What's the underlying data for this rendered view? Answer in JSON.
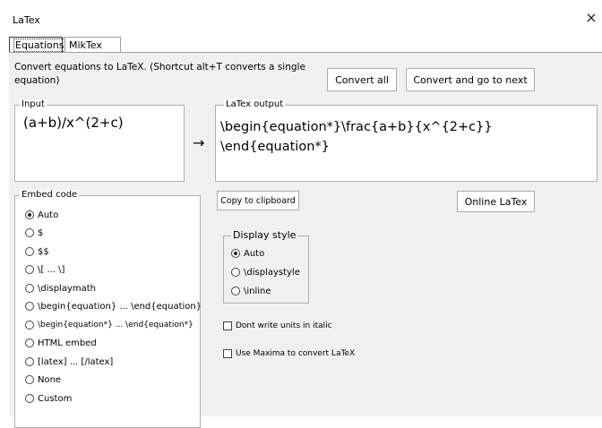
{
  "window": {
    "title": "LaTex",
    "close_glyph": "×"
  },
  "tabs": [
    {
      "label": "Equations",
      "active": true
    },
    {
      "label": "MikTex",
      "active": false
    }
  ],
  "instruction": "Convert equations to LaTeX. (Shortcut alt+T converts a single equation)",
  "buttons": {
    "convert_all": "Convert all",
    "convert_next": "Convert and go to next",
    "copy": "Copy to clipboard",
    "online": "Online LaTex"
  },
  "input": {
    "legend": "Input",
    "value": "(a+b)/x^(2+c)"
  },
  "arrow": "→",
  "output": {
    "legend": "LaTex output",
    "value": "\\begin{equation*}\\frac{a+b}{x^{2+c}}\n\\end{equation*}"
  },
  "embed": {
    "legend": "Embed code",
    "options": [
      {
        "label": "Auto",
        "checked": true
      },
      {
        "label": "$",
        "checked": false
      },
      {
        "label": "$$",
        "checked": false
      },
      {
        "label": "\\[ ... \\]",
        "checked": false
      },
      {
        "label": "\\displaymath",
        "checked": false
      },
      {
        "label": "\\begin{equation} ... \\end{equation}",
        "checked": false
      },
      {
        "label": "\\begin{equation*} ... \\end{equation*}",
        "checked": false
      },
      {
        "label": "HTML embed",
        "checked": false
      },
      {
        "label": "[latex] ... [/latex]",
        "checked": false
      },
      {
        "label": "None",
        "checked": false
      },
      {
        "label": "Custom",
        "checked": false
      }
    ]
  },
  "display_style": {
    "legend": "Display style",
    "options": [
      {
        "label": "Auto",
        "checked": true
      },
      {
        "label": "\\displaystyle",
        "checked": false
      },
      {
        "label": "\\inline",
        "checked": false
      }
    ]
  },
  "checkboxes": [
    {
      "label": "Dont write units in italic",
      "checked": false
    },
    {
      "label": "Use Maxima to convert LaTeX",
      "checked": false
    }
  ]
}
